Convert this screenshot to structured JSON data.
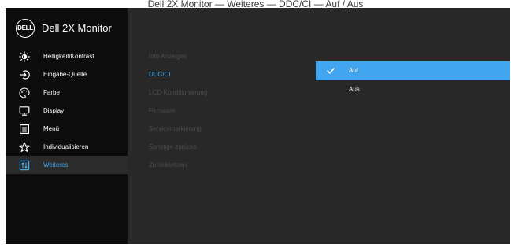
{
  "caption": "Dell 2X Monitor — Weiteres — DDC/CI — Auf / Aus",
  "brand": {
    "logo_text": "DELL",
    "model_name": "Dell 2X Monitor"
  },
  "sidebar": {
    "items": [
      {
        "label": "Helligkeit/Kontrast",
        "icon": "brightness-icon"
      },
      {
        "label": "Eingabe-Quelle",
        "icon": "input-source-icon"
      },
      {
        "label": "Farbe",
        "icon": "color-palette-icon"
      },
      {
        "label": "Display",
        "icon": "display-icon"
      },
      {
        "label": "Menü",
        "icon": "menu-icon"
      },
      {
        "label": "Individualisieren",
        "icon": "star-icon"
      },
      {
        "label": "Weiteres",
        "icon": "others-icon",
        "active": true
      }
    ]
  },
  "submenu": {
    "items": [
      {
        "label": "Info Anzeigen"
      },
      {
        "label": "DDC/CI",
        "active": true
      },
      {
        "label": "LCD-Konditionierung"
      },
      {
        "label": "Firmware"
      },
      {
        "label": "Servicemarkierung"
      },
      {
        "label": "Sonstige zurücks."
      },
      {
        "label": "Zurücksetzen"
      }
    ]
  },
  "options": {
    "items": [
      {
        "label": "Auf",
        "selected": true
      },
      {
        "label": "Aus"
      }
    ]
  },
  "colors": {
    "accent": "#41a5ef",
    "sidebar_bg": "#0c0c0c",
    "panel_bg": "#282828",
    "dim_text": "#4c4c4c"
  }
}
